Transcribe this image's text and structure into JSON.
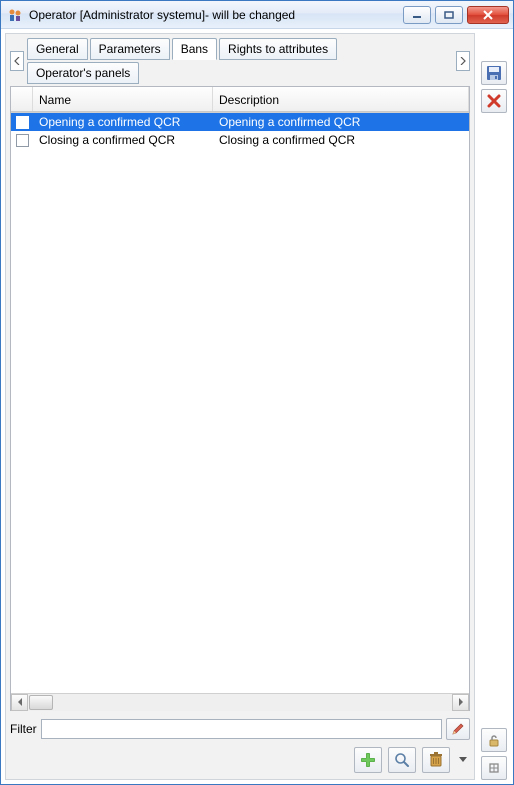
{
  "window": {
    "title": "Operator [Administrator systemu]- will be changed"
  },
  "tabs": {
    "items": [
      {
        "label": "General"
      },
      {
        "label": "Parameters"
      },
      {
        "label": "Bans"
      },
      {
        "label": "Rights to attributes"
      },
      {
        "label": "Operator's panels"
      }
    ],
    "active_index": 2
  },
  "table": {
    "columns": {
      "name": "Name",
      "description": "Description"
    },
    "rows": [
      {
        "checked": false,
        "name": "Opening a confirmed QCR",
        "description": "Opening a confirmed QCR",
        "selected": true
      },
      {
        "checked": false,
        "name": "Closing a confirmed QCR",
        "description": "Closing a confirmed QCR",
        "selected": false
      }
    ]
  },
  "filter": {
    "label": "Filter",
    "value": ""
  },
  "icons": {
    "save": "save-icon",
    "delete_red_x": "delete-x-icon",
    "pencil": "pencil-icon",
    "add": "add-icon",
    "magnify": "magnify-icon",
    "trash": "trash-icon",
    "lock": "lock-icon",
    "pin": "pin-icon"
  }
}
